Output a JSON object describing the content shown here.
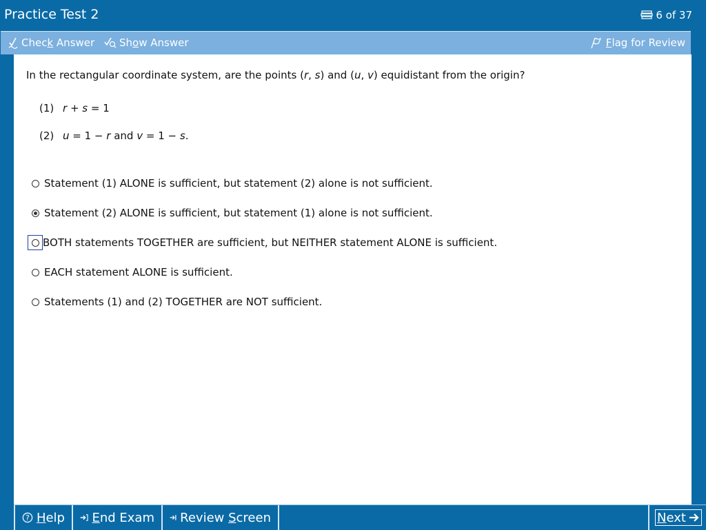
{
  "window": {
    "title": "Practice Test 2",
    "progress": "6 of 37"
  },
  "toolbar": {
    "check_answer": [
      "Chec",
      "k",
      " Answer"
    ],
    "show_answer": [
      "Sh",
      "o",
      "w Answer"
    ],
    "flag_review": [
      "",
      "F",
      "lag for Review"
    ]
  },
  "question": {
    "text": "In the rectangular coordinate system, are the points (r, s) and (u, v) equidistant from the origin?",
    "parts": [
      "In the rectangular coordinate system, are the points (",
      "r",
      ", ",
      "s",
      ") and (",
      "u",
      ", ",
      "v",
      ") equidistant from the origin?"
    ],
    "statements": [
      {
        "num": "(1)",
        "parts": [
          "r",
          " + ",
          "s",
          " = 1"
        ]
      },
      {
        "num": "(2)",
        "parts": [
          "u",
          " = 1 − ",
          "r",
          " and ",
          "v",
          " = 1 − ",
          "s",
          "."
        ]
      }
    ]
  },
  "options": [
    {
      "label": "Statement (1) ALONE is sufficient, but statement (2) alone is not sufficient.",
      "selected": false,
      "focused": false
    },
    {
      "label": "Statement (2) ALONE is sufficient, but statement (1) alone is not sufficient.",
      "selected": true,
      "focused": false
    },
    {
      "label": "BOTH statements TOGETHER are sufficient, but NEITHER statement ALONE is sufficient.",
      "selected": false,
      "focused": true
    },
    {
      "label": "EACH statement ALONE is sufficient.",
      "selected": false,
      "focused": false
    },
    {
      "label": "Statements (1) and (2) TOGETHER are NOT sufficient.",
      "selected": false,
      "focused": false
    }
  ],
  "bottombar": {
    "help": [
      "",
      "H",
      "elp"
    ],
    "end_exam": [
      "",
      "E",
      "nd Exam"
    ],
    "review_screen": [
      "Review ",
      "S",
      "creen"
    ],
    "next": [
      "",
      "N",
      "ext"
    ]
  },
  "colors": {
    "chrome": "#0a6aa6",
    "toolbar": "#7bb0df",
    "focus": "#1c3fa8"
  },
  "icons": {
    "counter": "stack-icon",
    "check": "check-answer-icon",
    "show": "show-answer-icon",
    "flag": "flag-icon",
    "help": "help-circle-icon",
    "end": "exit-arrow-icon",
    "review": "review-arrow-icon",
    "next": "arrow-right-icon"
  }
}
